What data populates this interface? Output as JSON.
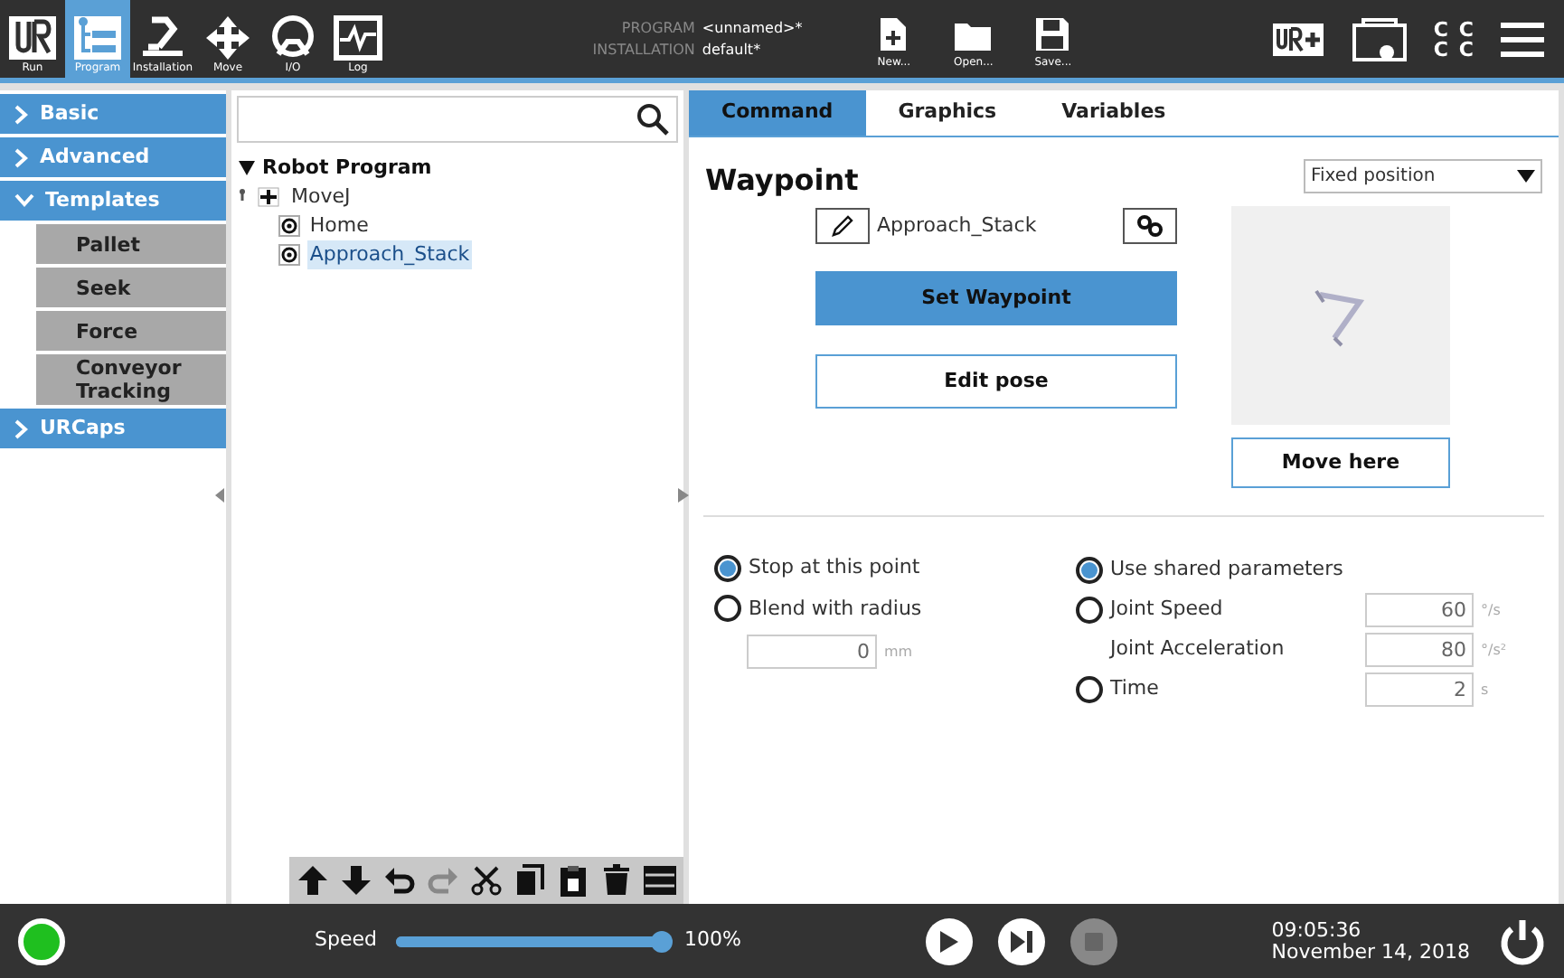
{
  "toolbar": {
    "tabs": [
      {
        "label": "Run",
        "kind": "run",
        "selected": false
      },
      {
        "label": "Program",
        "kind": "program",
        "selected": true
      },
      {
        "label": "Installation",
        "kind": "installation",
        "selected": false
      },
      {
        "label": "Move",
        "kind": "move",
        "selected": false
      },
      {
        "label": "I/O",
        "kind": "io",
        "selected": false
      },
      {
        "label": "Log",
        "kind": "log",
        "selected": false
      }
    ],
    "program_label": "PROGRAM",
    "program_value": "<unnamed>*",
    "installation_label": "INSTALLATION",
    "installation_value": "default*",
    "file_buttons": [
      {
        "label": "New...",
        "kind": "new"
      },
      {
        "label": "Open...",
        "kind": "open"
      },
      {
        "label": "Save...",
        "kind": "save"
      }
    ],
    "status_letters": [
      "C",
      "C",
      "C",
      "C"
    ]
  },
  "sidebar": {
    "items": [
      {
        "label": "Basic",
        "expanded": false
      },
      {
        "label": "Advanced",
        "expanded": false
      },
      {
        "label": "Templates",
        "expanded": true,
        "children": [
          {
            "label": "Pallet"
          },
          {
            "label": "Seek"
          },
          {
            "label": "Force"
          },
          {
            "label": "Conveyor Tracking"
          }
        ]
      },
      {
        "label": "URCaps",
        "expanded": false
      }
    ]
  },
  "tree": {
    "root": "Robot Program",
    "children": [
      {
        "label": "MoveJ",
        "kind": "move",
        "selected": false,
        "children": [
          {
            "label": "Home",
            "kind": "waypoint",
            "selected": false
          },
          {
            "label": "Approach_Stack",
            "kind": "waypoint",
            "selected": true
          }
        ]
      }
    ]
  },
  "panel": {
    "tabs": [
      {
        "label": "Command",
        "selected": true
      },
      {
        "label": "Graphics",
        "selected": false
      },
      {
        "label": "Variables",
        "selected": false
      }
    ],
    "title": "Waypoint",
    "position_mode": "Fixed position",
    "waypoint_name": "Approach_Stack",
    "set_button": "Set Waypoint",
    "edit_button": "Edit pose",
    "move_button": "Move here",
    "stop_options": [
      {
        "label": "Stop at this point",
        "selected": true
      },
      {
        "label": "Blend with radius",
        "selected": false
      }
    ],
    "radius": {
      "value": "0",
      "unit": "mm"
    },
    "param_options": [
      {
        "label": "Use shared parameters",
        "kind": "radio",
        "selected": true
      },
      {
        "label": "Joint Speed",
        "kind": "radio",
        "selected": false,
        "value": "60",
        "unit": "°/s"
      },
      {
        "label": "Joint Acceleration",
        "kind": "plain",
        "value": "80",
        "unit": "°/s²"
      },
      {
        "label": "Time",
        "kind": "radio",
        "selected": false,
        "value": "2",
        "unit": "s"
      }
    ]
  },
  "footer": {
    "speed_label": "Speed",
    "speed": {
      "level": 1.0
    },
    "speed_reading": "100%",
    "time": "09:05:36",
    "date": "November 14, 2018"
  }
}
